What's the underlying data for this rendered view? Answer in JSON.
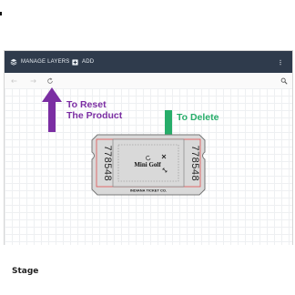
{
  "toolbar": {
    "manage_layers_label": "MANAGE LAYERS",
    "add_label": "ADD",
    "icons": [
      "layers-icon",
      "add-icon",
      "more-vert-icon",
      "undo-icon",
      "redo-icon",
      "reset-icon",
      "zoom-icon"
    ]
  },
  "annotations": {
    "reset": "To Reset\nThe Product",
    "delete": "To Delete"
  },
  "colors": {
    "topbar": "#2f3b4c",
    "reset_arrow": "#7b2ea3",
    "delete_arrow": "#27ad6a",
    "ticket_border": "#e05050"
  },
  "ticket": {
    "number_left": "778548",
    "number_right": "778548",
    "title": "Mini Golf",
    "footer": "INDIANA TICKET CO."
  },
  "stage": {
    "label": "Stage"
  }
}
